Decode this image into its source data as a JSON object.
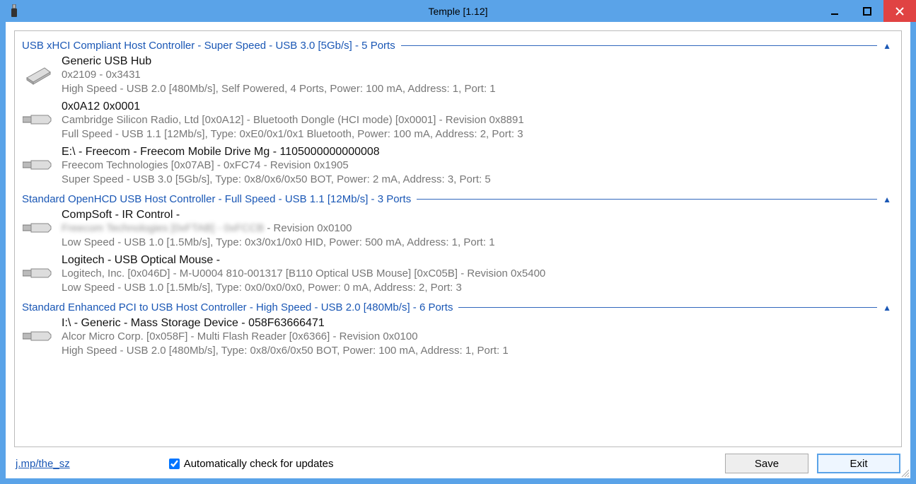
{
  "window": {
    "title": "Temple [1.12]"
  },
  "controllers": [
    {
      "title": "USB xHCI Compliant Host Controller - Super Speed - USB 3.0 [5Gb/s] - 5 Ports",
      "devices": [
        {
          "icon": "drive",
          "name": "Generic USB Hub",
          "line1": "0x2109 - 0x3431",
          "line2": "High Speed - USB 2.0 [480Mb/s], Self Powered, 4 Ports, Power: 100 mA, Address: 1, Port: 1"
        },
        {
          "icon": "usb",
          "name": "0x0A12 0x0001",
          "line1": "Cambridge Silicon Radio, Ltd [0x0A12] - Bluetooth Dongle (HCI mode) [0x0001] - Revision 0x8891",
          "line2": "Full Speed - USB 1.1 [12Mb/s], Type: 0xE0/0x1/0x1 Bluetooth, Power: 100 mA, Address: 2, Port: 3"
        },
        {
          "icon": "usb",
          "name": "E:\\ - Freecom - Freecom Mobile Drive Mg - 1105000000000008",
          "line1": "Freecom Technologies [0x07AB] - 0xFC74 - Revision 0x1905",
          "line2": "Super Speed - USB 3.0 [5Gb/s], Type: 0x8/0x6/0x50 BOT, Power: 2 mA, Address: 3, Port: 5"
        }
      ]
    },
    {
      "title": "Standard OpenHCD USB Host Controller - Full Speed - USB 1.1 [12Mb/s] - 3 Ports",
      "devices": [
        {
          "icon": "usb",
          "name": "CompSoft - IR Control -",
          "line1_blur": "Freecom Technologies [0xFTAB] - 0xFCCB",
          "line1_tail": " - Revision 0x0100",
          "line2": "Low Speed - USB 1.0 [1.5Mb/s], Type: 0x3/0x1/0x0 HID, Power: 500 mA, Address: 1, Port: 1"
        },
        {
          "icon": "usb",
          "name": "Logitech - USB Optical Mouse -",
          "line1": "Logitech, Inc. [0x046D] - M-U0004 810-001317 [B110 Optical USB Mouse] [0xC05B] - Revision 0x5400",
          "line2": "Low Speed - USB 1.0 [1.5Mb/s], Type: 0x0/0x0/0x0, Power: 0 mA, Address: 2, Port: 3"
        }
      ]
    },
    {
      "title": "Standard Enhanced PCI to USB Host Controller - High Speed - USB 2.0 [480Mb/s] - 6 Ports",
      "devices": [
        {
          "icon": "usb",
          "name": "I:\\ - Generic - Mass Storage Device - 058F63666471",
          "line1": "Alcor Micro Corp. [0x058F] - Multi Flash Reader [0x6366] - Revision 0x0100",
          "line2": "High Speed - USB 2.0 [480Mb/s], Type: 0x8/0x6/0x50 BOT, Power: 100 mA, Address: 1, Port: 1"
        }
      ]
    }
  ],
  "footer": {
    "link": "j.mp/the_sz",
    "checkbox": "Automatically check for updates",
    "save": "Save",
    "exit": "Exit"
  }
}
